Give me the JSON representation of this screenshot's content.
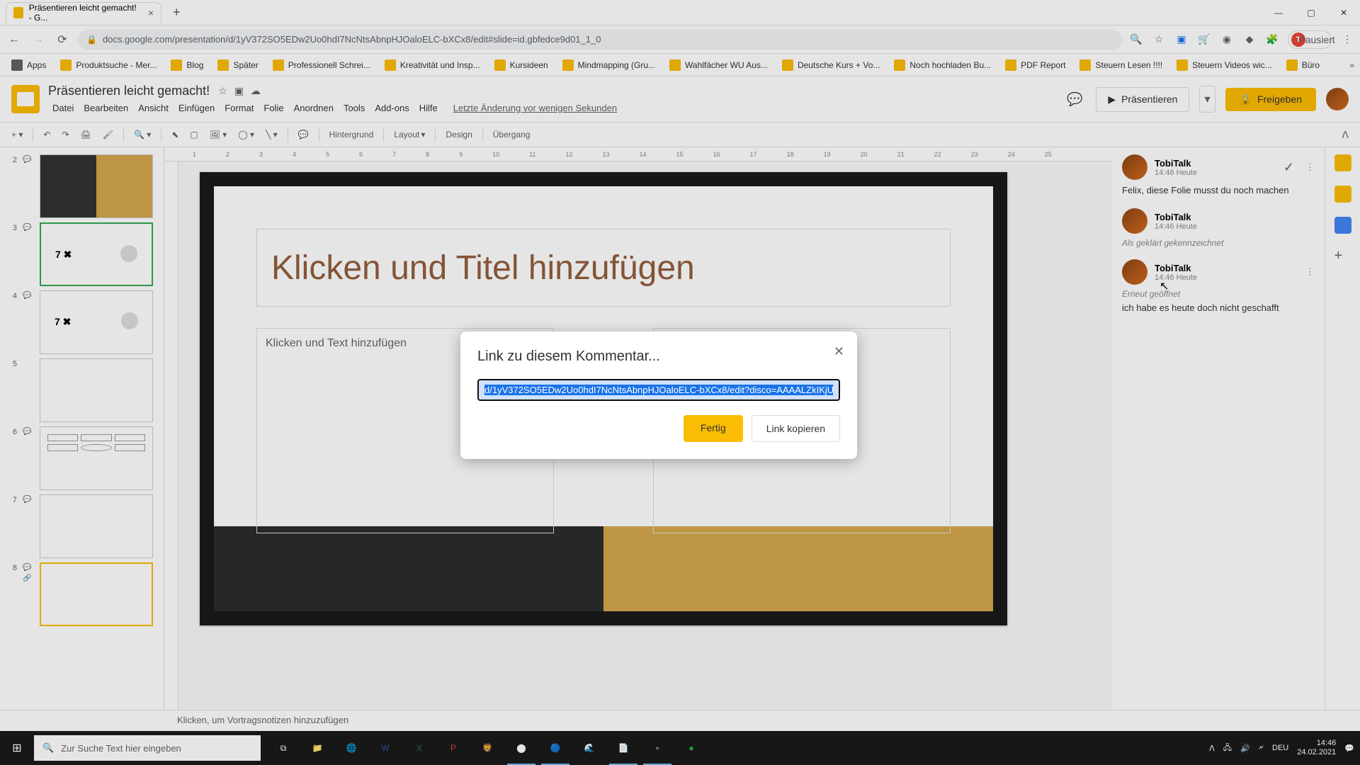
{
  "browser": {
    "tab_title": "Präsentieren leicht gemacht! - G...",
    "url": "docs.google.com/presentation/d/1yV372SO5EDw2Uo0hdI7NcNtsAbnpHJOaloELC-bXCx8/edit#slide=id.gbfedce9d01_1_0",
    "profile_status": "Pausiert",
    "profile_initial": "T"
  },
  "bookmarks": [
    "Apps",
    "Produktsuche - Mer...",
    "Blog",
    "Später",
    "Professionell Schrei...",
    "Kreativität und Insp...",
    "Kursideen",
    "Mindmapping (Gru...",
    "Wahlfächer WU Aus...",
    "Deutsche Kurs + Vo...",
    "Noch hochladen Bu...",
    "PDF Report",
    "Steuern Lesen !!!!",
    "Steuern Videos wic...",
    "Büro"
  ],
  "app": {
    "doc_title": "Präsentieren leicht gemacht!",
    "last_edit": "Letzte Änderung vor wenigen Sekunden",
    "present": "Präsentieren",
    "share": "Freigeben"
  },
  "menus": [
    "Datei",
    "Bearbeiten",
    "Ansicht",
    "Einfügen",
    "Format",
    "Folie",
    "Anordnen",
    "Tools",
    "Add-ons",
    "Hilfe"
  ],
  "toolbar": {
    "hintergrund": "Hintergrund",
    "layout": "Layout",
    "design": "Design",
    "uebergang": "Übergang"
  },
  "ruler": [
    "1",
    "2",
    "3",
    "4",
    "5",
    "6",
    "7",
    "8",
    "9",
    "10",
    "11",
    "12",
    "13",
    "14",
    "15",
    "16",
    "17",
    "18",
    "19",
    "20",
    "21",
    "22",
    "23",
    "24",
    "25"
  ],
  "slide": {
    "title_placeholder": "Klicken und Titel hinzufügen",
    "body_placeholder": "Klicken und Text hinzufügen"
  },
  "notes_placeholder": "Klicken, um Vortragsnotizen hinzuzufügen",
  "comments": [
    {
      "author": "TobiTalk",
      "time": "14:46 Heute",
      "text": "Felix, diese Folie musst du noch machen",
      "resolved": true
    },
    {
      "author": "TobiTalk",
      "time": "14:46 Heute",
      "status": "Als geklärt gekennzeichnet"
    },
    {
      "author": "TobiTalk",
      "time": "14:46 Heute",
      "status": "Erneut geöffnet",
      "text": "ich habe es heute doch nicht geschafft"
    }
  ],
  "modal": {
    "title": "Link zu diesem Kommentar...",
    "value": "d/1yV372SO5EDw2Uo0hdI7NcNtsAbnpHJOaloELC-bXCx8/edit?disco=AAAALZkIKjU",
    "done": "Fertig",
    "copy": "Link kopieren"
  },
  "thumbs": [
    {
      "num": "2"
    },
    {
      "num": "3"
    },
    {
      "num": "4"
    },
    {
      "num": "5"
    },
    {
      "num": "6"
    },
    {
      "num": "7"
    },
    {
      "num": "8"
    }
  ],
  "taskbar": {
    "search_placeholder": "Zur Suche Text hier eingeben",
    "lang": "DEU",
    "time": "14:46",
    "date": "24.02.2021"
  }
}
